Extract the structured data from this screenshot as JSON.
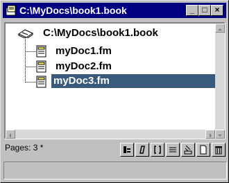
{
  "window": {
    "title": "C:\\MyDocs\\book1.book",
    "controls": [
      "_",
      "□",
      "×"
    ]
  },
  "tree": {
    "root": {
      "label": "C:\\MyDocs\\book1.book",
      "icon": "book-icon"
    },
    "children": [
      {
        "label": "myDoc1.fm",
        "icon": "document-icon",
        "selected": false
      },
      {
        "label": "myDoc2.fm",
        "icon": "document-icon",
        "selected": false
      },
      {
        "label": "myDoc3.fm",
        "icon": "document-icon",
        "selected": true
      }
    ]
  },
  "status": {
    "pages_label": "Pages: 3 *",
    "tools": [
      "update-book-icon",
      "edit-book-icon",
      "brackets-icon",
      "list-icon",
      "stamp-icon",
      "new-document-icon",
      "trash-icon"
    ]
  },
  "colors": {
    "titlebar": "#000080",
    "selection": "#3a5a7c",
    "chrome": "#c0c0c0"
  }
}
